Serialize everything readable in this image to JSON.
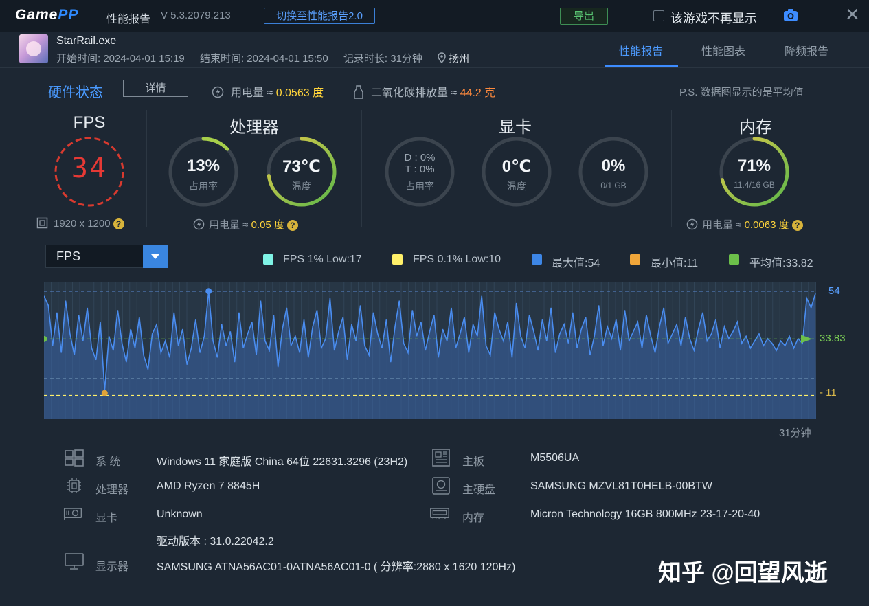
{
  "window": {
    "brand_a": "Game",
    "brand_b": "PP",
    "title": "性能报告",
    "version": "V 5.3.2079.213",
    "switch_btn": "切换至性能报告2.0",
    "export_btn": "导出",
    "hide_label": "该游戏不再显示",
    "close_glyph": "✕"
  },
  "session": {
    "exe": "StarRail.exe",
    "start": "开始时间: 2024-04-01 15:19",
    "end": "结束时间: 2024-04-01 15:50",
    "duration": "记录时长: 31分钟",
    "location": "扬州"
  },
  "tabs": [
    {
      "label": "性能报告",
      "active": true
    },
    {
      "label": "性能图表",
      "active": false
    },
    {
      "label": "降频报告",
      "active": false
    }
  ],
  "hardware": {
    "title": "硬件状态",
    "detail_btn": "详情",
    "power_label": "用电量 ≈ ",
    "power_value": "0.0563 度",
    "co2_label": "二氧化碳排放量 ≈ ",
    "co2_value": "44.2 克",
    "ps_note": "P.S. 数据图显示的是平均值"
  },
  "fps_panel": {
    "title": "FPS",
    "value": "34",
    "resolution": "1920 x 1200"
  },
  "cpu_panel": {
    "title": "处理器",
    "usage_value": "13%",
    "usage_label": "占用率",
    "usage_pct": 13,
    "temp_value": "73℃",
    "temp_label": "温度",
    "temp_pct": 73,
    "power_label": "用电量 ≈ ",
    "power_value": "0.05 度"
  },
  "gpu_panel": {
    "title": "显卡",
    "d_line": "D : 0%",
    "t_line": "T : 0%",
    "usage_label": "占用率",
    "temp_value": "0℃",
    "temp_label": "温度",
    "vram_value": "0%",
    "vram_label": "0/1 GB"
  },
  "mem_panel": {
    "title": "内存",
    "value": "71%",
    "label": "11.4/16 GB",
    "pct": 71,
    "power_label": "用电量 ≈ ",
    "power_value": "0.0063 度"
  },
  "metric_select": {
    "value": "FPS"
  },
  "legend": [
    {
      "label": "FPS 1% Low:17",
      "color": "#7ff3e6"
    },
    {
      "label": "FPS 0.1% Low:10",
      "color": "#fff06a"
    },
    {
      "label": "最大值:54",
      "color": "#3d86e6"
    },
    {
      "label": "最小值:11",
      "color": "#f0a63a"
    },
    {
      "label": "平均值:33.82",
      "color": "#6cc04a"
    }
  ],
  "chart_data": {
    "type": "area",
    "metric": "FPS",
    "x_end_label": "31分钟",
    "max": 54,
    "min": 11,
    "avg": 33.83,
    "low_1pct": 17,
    "low_01pct": 10,
    "ylim": [
      0,
      58
    ],
    "y_labels": {
      "max": "54",
      "avg": "33.83",
      "min": "11"
    },
    "values": [
      52,
      48,
      31,
      45,
      28,
      50,
      36,
      27,
      44,
      33,
      47,
      30,
      25,
      41,
      12,
      35,
      29,
      46,
      32,
      24,
      38,
      30,
      43,
      27,
      21,
      36,
      40,
      28,
      33,
      26,
      45,
      31,
      38,
      23,
      30,
      42,
      28,
      35,
      54,
      33,
      26,
      40,
      31,
      37,
      24,
      45,
      30,
      36,
      41,
      27,
      50,
      33,
      29,
      44,
      22,
      38,
      47,
      31,
      35,
      28,
      42,
      26,
      39,
      46,
      30,
      34,
      51,
      29,
      37,
      43,
      25,
      40,
      33,
      48,
      31,
      27,
      45,
      36,
      30,
      42,
      24,
      39,
      50,
      32,
      28,
      46,
      35,
      41,
      29,
      37,
      44,
      26,
      38,
      33,
      47,
      30,
      36,
      43,
      28,
      40,
      35,
      52,
      31,
      27,
      45,
      38,
      33,
      41,
      26,
      49,
      35,
      30,
      44,
      37,
      29,
      42,
      33,
      47,
      28,
      36,
      40,
      32,
      45,
      30,
      38,
      43,
      27,
      35,
      48,
      31,
      39,
      34,
      42,
      29,
      46,
      33,
      37,
      41,
      30,
      44,
      35,
      28,
      39,
      47,
      32,
      36,
      40,
      31,
      43,
      34,
      29,
      38,
      45,
      33,
      36,
      42,
      30,
      39,
      34,
      37,
      41,
      32,
      35,
      30,
      33,
      36,
      31,
      34,
      32,
      29,
      33,
      31,
      35,
      30,
      34,
      32,
      51,
      47,
      53
    ]
  },
  "sysinfo": {
    "os_k": "系 统",
    "os_v": "Windows 11 家庭版 China 64位 22631.3296 (23H2)",
    "cpu_k": "处理器",
    "cpu_v": "AMD Ryzen 7 8845H",
    "gpu_k": "显卡",
    "gpu_v": "Unknown",
    "driver_v": "驱动版本 : 31.0.22042.2",
    "mon_k": "显示器",
    "mon_v": "SAMSUNG ATNA56AC01-0ATNA56AC01-0 ( 分辨率:2880 x 1620 120Hz)",
    "mb_k": "主板",
    "mb_v": "M5506UA",
    "disk_k": "主硬盘",
    "disk_v": "SAMSUNG MZVL81T0HELB-00BTW",
    "ram_k": "内存",
    "ram_v": "Micron Technology 16GB 800MHz 23-17-20-40"
  },
  "watermark": "知乎 @回望风逝"
}
